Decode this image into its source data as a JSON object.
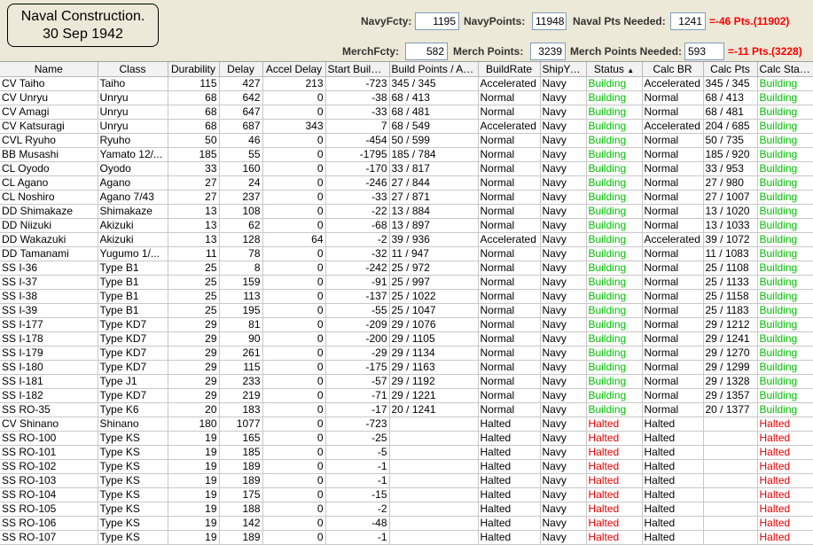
{
  "title": {
    "line1": "Naval Construction.",
    "line2": "30 Sep 1942"
  },
  "navy": {
    "fcty_label": "NavyFcty:",
    "fcty_value": "1195",
    "points_label": "NavyPoints:",
    "points_value": "11948",
    "needed_label": "Naval Pts Needed:",
    "needed_value": "1241",
    "deficit": "=-46 Pts.(11902)"
  },
  "merch": {
    "fcty_label": "MerchFcty:",
    "fcty_value": "582",
    "points_label": "Merch Points:",
    "points_value": "3239",
    "needed_label": "Merch Points Needed:",
    "needed_value": "593",
    "deficit": "=-11 Pts.(3228)"
  },
  "colors": {
    "building": "#00c000",
    "halted": "#e00000",
    "deficit": "#ff0000"
  },
  "sort_icon": "sort-ascending-icon",
  "columns": [
    "Name",
    "Class",
    "Durability",
    "Delay",
    "Accel Delay",
    "Start Buildi...",
    "Build Points / Ag...",
    "BuildRate",
    "ShipYard",
    "Status",
    "Calc BR",
    "Calc Pts",
    "Calc Status"
  ],
  "rows": [
    [
      "CV Taiho",
      "Taiho",
      "115",
      "427",
      "213",
      "-723",
      "345 / 345",
      "Accelerated",
      "Navy",
      "Building",
      "Accelerated",
      "345 / 345",
      "Building"
    ],
    [
      "CV Unryu",
      "Unryu",
      "68",
      "642",
      "0",
      "-38",
      "68 / 413",
      "Normal",
      "Navy",
      "Building",
      "Normal",
      "68 / 413",
      "Building"
    ],
    [
      "CV Amagi",
      "Unryu",
      "68",
      "647",
      "0",
      "-33",
      "68 / 481",
      "Normal",
      "Navy",
      "Building",
      "Normal",
      "68 / 481",
      "Building"
    ],
    [
      "CV Katsuragi",
      "Unryu",
      "68",
      "687",
      "343",
      "7",
      "68 / 549",
      "Accelerated",
      "Navy",
      "Building",
      "Accelerated",
      "204 / 685",
      "Building"
    ],
    [
      "CVL Ryuho",
      "Ryuho",
      "50",
      "46",
      "0",
      "-454",
      "50 / 599",
      "Normal",
      "Navy",
      "Building",
      "Normal",
      "50 / 735",
      "Building"
    ],
    [
      "BB Musashi",
      "Yamato 12/...",
      "185",
      "55",
      "0",
      "-1795",
      "185 / 784",
      "Normal",
      "Navy",
      "Building",
      "Normal",
      "185 / 920",
      "Building"
    ],
    [
      "CL Oyodo",
      "Oyodo",
      "33",
      "160",
      "0",
      "-170",
      "33 / 817",
      "Normal",
      "Navy",
      "Building",
      "Normal",
      "33 / 953",
      "Building"
    ],
    [
      "CL Agano",
      "Agano",
      "27",
      "24",
      "0",
      "-246",
      "27 / 844",
      "Normal",
      "Navy",
      "Building",
      "Normal",
      "27 / 980",
      "Building"
    ],
    [
      "CL Noshiro",
      "Agano 7/43",
      "27",
      "237",
      "0",
      "-33",
      "27 / 871",
      "Normal",
      "Navy",
      "Building",
      "Normal",
      "27 / 1007",
      "Building"
    ],
    [
      "DD Shimakaze",
      "Shimakaze",
      "13",
      "108",
      "0",
      "-22",
      "13 / 884",
      "Normal",
      "Navy",
      "Building",
      "Normal",
      "13 / 1020",
      "Building"
    ],
    [
      "DD Niizuki",
      "Akizuki",
      "13",
      "62",
      "0",
      "-68",
      "13 / 897",
      "Normal",
      "Navy",
      "Building",
      "Normal",
      "13 / 1033",
      "Building"
    ],
    [
      "DD Wakazuki",
      "Akizuki",
      "13",
      "128",
      "64",
      "-2",
      "39 / 936",
      "Accelerated",
      "Navy",
      "Building",
      "Accelerated",
      "39 / 1072",
      "Building"
    ],
    [
      "DD Tamanami",
      "Yugumo 1/...",
      "11",
      "78",
      "0",
      "-32",
      "11 / 947",
      "Normal",
      "Navy",
      "Building",
      "Normal",
      "11 / 1083",
      "Building"
    ],
    [
      "SS I-36",
      "Type B1",
      "25",
      "8",
      "0",
      "-242",
      "25 / 972",
      "Normal",
      "Navy",
      "Building",
      "Normal",
      "25 / 1108",
      "Building"
    ],
    [
      "SS I-37",
      "Type B1",
      "25",
      "159",
      "0",
      "-91",
      "25 / 997",
      "Normal",
      "Navy",
      "Building",
      "Normal",
      "25 / 1133",
      "Building"
    ],
    [
      "SS I-38",
      "Type B1",
      "25",
      "113",
      "0",
      "-137",
      "25 / 1022",
      "Normal",
      "Navy",
      "Building",
      "Normal",
      "25 / 1158",
      "Building"
    ],
    [
      "SS I-39",
      "Type B1",
      "25",
      "195",
      "0",
      "-55",
      "25 / 1047",
      "Normal",
      "Navy",
      "Building",
      "Normal",
      "25 / 1183",
      "Building"
    ],
    [
      "SS I-177",
      "Type KD7",
      "29",
      "81",
      "0",
      "-209",
      "29 / 1076",
      "Normal",
      "Navy",
      "Building",
      "Normal",
      "29 / 1212",
      "Building"
    ],
    [
      "SS I-178",
      "Type KD7",
      "29",
      "90",
      "0",
      "-200",
      "29 / 1105",
      "Normal",
      "Navy",
      "Building",
      "Normal",
      "29 / 1241",
      "Building"
    ],
    [
      "SS I-179",
      "Type KD7",
      "29",
      "261",
      "0",
      "-29",
      "29 / 1134",
      "Normal",
      "Navy",
      "Building",
      "Normal",
      "29 / 1270",
      "Building"
    ],
    [
      "SS I-180",
      "Type KD7",
      "29",
      "115",
      "0",
      "-175",
      "29 / 1163",
      "Normal",
      "Navy",
      "Building",
      "Normal",
      "29 / 1299",
      "Building"
    ],
    [
      "SS I-181",
      "Type J1",
      "29",
      "233",
      "0",
      "-57",
      "29 / 1192",
      "Normal",
      "Navy",
      "Building",
      "Normal",
      "29 / 1328",
      "Building"
    ],
    [
      "SS I-182",
      "Type KD7",
      "29",
      "219",
      "0",
      "-71",
      "29 / 1221",
      "Normal",
      "Navy",
      "Building",
      "Normal",
      "29 / 1357",
      "Building"
    ],
    [
      "SS RO-35",
      "Type K6",
      "20",
      "183",
      "0",
      "-17",
      "20 / 1241",
      "Normal",
      "Navy",
      "Building",
      "Normal",
      "20 / 1377",
      "Building"
    ],
    [
      "CV Shinano",
      "Shinano",
      "180",
      "1077",
      "0",
      "-723",
      "",
      "Halted",
      "Navy",
      "Halted",
      "Halted",
      "",
      "Halted"
    ],
    [
      "SS RO-100",
      "Type KS",
      "19",
      "165",
      "0",
      "-25",
      "",
      "Halted",
      "Navy",
      "Halted",
      "Halted",
      "",
      "Halted"
    ],
    [
      "SS RO-101",
      "Type KS",
      "19",
      "185",
      "0",
      "-5",
      "",
      "Halted",
      "Navy",
      "Halted",
      "Halted",
      "",
      "Halted"
    ],
    [
      "SS RO-102",
      "Type KS",
      "19",
      "189",
      "0",
      "-1",
      "",
      "Halted",
      "Navy",
      "Halted",
      "Halted",
      "",
      "Halted"
    ],
    [
      "SS RO-103",
      "Type KS",
      "19",
      "189",
      "0",
      "-1",
      "",
      "Halted",
      "Navy",
      "Halted",
      "Halted",
      "",
      "Halted"
    ],
    [
      "SS RO-104",
      "Type KS",
      "19",
      "175",
      "0",
      "-15",
      "",
      "Halted",
      "Navy",
      "Halted",
      "Halted",
      "",
      "Halted"
    ],
    [
      "SS RO-105",
      "Type KS",
      "19",
      "188",
      "0",
      "-2",
      "",
      "Halted",
      "Navy",
      "Halted",
      "Halted",
      "",
      "Halted"
    ],
    [
      "SS RO-106",
      "Type KS",
      "19",
      "142",
      "0",
      "-48",
      "",
      "Halted",
      "Navy",
      "Halted",
      "Halted",
      "",
      "Halted"
    ],
    [
      "SS RO-107",
      "Type KS",
      "19",
      "189",
      "0",
      "-1",
      "",
      "Halted",
      "Navy",
      "Halted",
      "Halted",
      "",
      "Halted"
    ]
  ]
}
